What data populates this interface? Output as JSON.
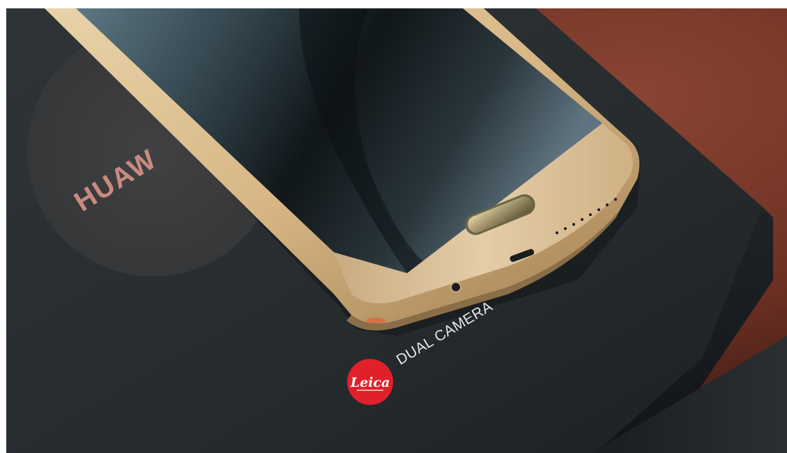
{
  "photo": {
    "brand_print": "HUAW",
    "box_tagline": "DUAL CAMERA",
    "leica_logo_text": "Leica",
    "colors": {
      "box_dark": "#262b2e",
      "box_circle": "#3a3c3e",
      "brand_print": "#c98a80",
      "wood": "#7a3a2a",
      "phone_gold": "#d9b987",
      "screen": "#1f2a30",
      "leica_red": "#e0202a"
    }
  }
}
